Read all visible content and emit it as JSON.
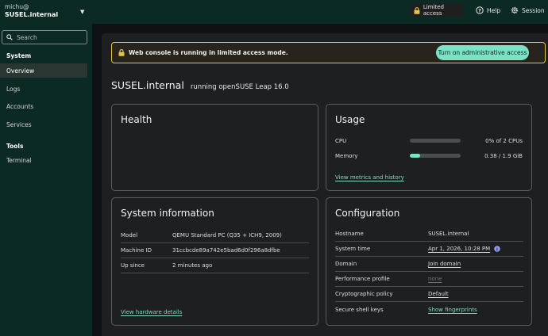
{
  "header": {
    "user": "michu@",
    "host": "SUSEL.internal",
    "limited_access": "Limited access",
    "help": "Help",
    "session": "Session"
  },
  "sidebar": {
    "search_placeholder": "Search",
    "sections": [
      {
        "label": "System",
        "items": [
          "Overview",
          "Logs",
          "Accounts",
          "Services"
        ]
      },
      {
        "label": "Tools",
        "items": [
          "Terminal"
        ]
      }
    ],
    "active_item": "Overview"
  },
  "alert": {
    "message": "Web console is running in limited access mode.",
    "button": "Turn on administrative access"
  },
  "title": {
    "host": "SUSEL.internal",
    "os": "running openSUSE Leap 16.0"
  },
  "health": {
    "title": "Health"
  },
  "usage": {
    "title": "Usage",
    "cpu_label": "CPU",
    "cpu_value": "0% of 2 CPUs",
    "cpu_fraction": 0.0,
    "memory_label": "Memory",
    "memory_value": "0.38 / 1.9 GiB",
    "memory_fraction": 0.2,
    "link": "View metrics and history"
  },
  "sysinfo": {
    "title": "System information",
    "rows": [
      {
        "label": "Model",
        "value": "QEMU Standard PC (Q35 + ICH9, 2009)"
      },
      {
        "label": "Machine ID",
        "value": "31ccbcde89a742e5bad6d0f296a8dfbe"
      },
      {
        "label": "Up since",
        "value": "2 minutes ago"
      }
    ],
    "link": "View hardware details"
  },
  "config": {
    "title": "Configuration",
    "rows": [
      {
        "label": "Hostname",
        "value": "SUSEL.internal"
      },
      {
        "label": "System time",
        "value": "Apr 1, 2026, 10:28 PM"
      },
      {
        "label": "Domain",
        "value": "Join domain"
      },
      {
        "label": "Performance profile",
        "value": "none"
      },
      {
        "label": "Cryptographic policy",
        "value": "Default"
      },
      {
        "label": "Secure shell keys",
        "value": "Show fingerprints"
      }
    ]
  },
  "colors": {
    "accent": "#7ce2c6",
    "warning": "#e5c649",
    "masthead": "#0b2a24"
  }
}
